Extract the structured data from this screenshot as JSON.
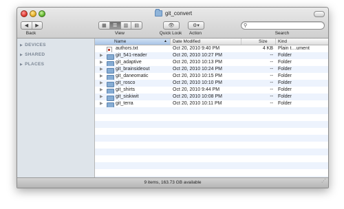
{
  "window": {
    "title": "git_convert"
  },
  "toolbar": {
    "back_label": "Back",
    "view_label": "View",
    "quicklook_label": "Quick Look",
    "action_label": "Action",
    "search_label": "Search",
    "search_placeholder": ""
  },
  "sidebar": {
    "groups": [
      {
        "label": "DEVICES"
      },
      {
        "label": "SHARED"
      },
      {
        "label": "PLACES"
      }
    ]
  },
  "columns": {
    "name": "Name",
    "date": "Date Modified",
    "size": "Size",
    "kind": "Kind"
  },
  "files": [
    {
      "name": "authors.txt",
      "date": "Oct 20, 2010 9:40 PM",
      "size": "4 KB",
      "kind": "Plain t…ument",
      "type": "document"
    },
    {
      "name": "git_541-reader",
      "date": "Oct 20, 2010 10:27 PM",
      "size": "--",
      "kind": "Folder",
      "type": "folder"
    },
    {
      "name": "git_adaptive",
      "date": "Oct 20, 2010 10:13 PM",
      "size": "--",
      "kind": "Folder",
      "type": "folder"
    },
    {
      "name": "git_brainsideout",
      "date": "Oct 20, 2010 10:24 PM",
      "size": "--",
      "kind": "Folder",
      "type": "folder"
    },
    {
      "name": "git_daneomatic",
      "date": "Oct 20, 2010 10:15 PM",
      "size": "--",
      "kind": "Folder",
      "type": "folder"
    },
    {
      "name": "git_rosco",
      "date": "Oct 20, 2010 10:10 PM",
      "size": "--",
      "kind": "Folder",
      "type": "folder"
    },
    {
      "name": "git_shirts",
      "date": "Oct 20, 2010 9:44 PM",
      "size": "--",
      "kind": "Folder",
      "type": "folder"
    },
    {
      "name": "git_siskiwit",
      "date": "Oct 20, 2010 10:08 PM",
      "size": "--",
      "kind": "Folder",
      "type": "folder"
    },
    {
      "name": "git_terra",
      "date": "Oct 20, 2010 10:11 PM",
      "size": "--",
      "kind": "Folder",
      "type": "folder"
    }
  ],
  "status": {
    "text": "9 items, 163.73 GB available"
  }
}
